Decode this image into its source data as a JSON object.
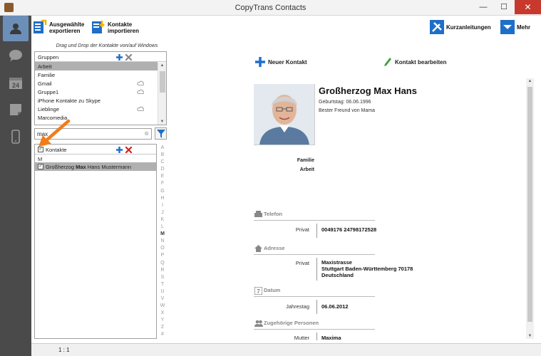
{
  "window": {
    "title": "CopyTrans Contacts",
    "minimize": "—",
    "maximize": "☐",
    "close": "✕"
  },
  "toolbar": {
    "export_label_1": "Ausgewählte",
    "export_label_2": "exportieren",
    "import_label_1": "Kontakte",
    "import_label_2": "importieren",
    "guides_label": "Kurzanleitungen",
    "more_label": "Mehr"
  },
  "sidebar": {
    "items": [
      "contacts-icon",
      "messages-icon",
      "calendar-icon",
      "notes-icon",
      "device-icon"
    ],
    "calendar_day": "24"
  },
  "left": {
    "hint": "Drag und Drop der Kontakte von/auf Windows",
    "groups_header": "Gruppen",
    "groups": [
      {
        "label": "Arbeit",
        "cloud": false,
        "selected": true
      },
      {
        "label": "Familie",
        "cloud": false
      },
      {
        "label": "Gmail",
        "cloud": true
      },
      {
        "label": "Gruppe1",
        "cloud": true
      },
      {
        "label": "iPhone Kontakte zu Skype",
        "cloud": false
      },
      {
        "label": "Lieblinge",
        "cloud": true
      },
      {
        "label": "Marcomedia",
        "cloud": false
      }
    ],
    "search_value": "max",
    "contacts_header": "Kontakte",
    "letter": "M",
    "contact_pre": "Großherzog ",
    "contact_bold": "Max",
    "contact_post": " Hans Mustermann",
    "alphabet": [
      "A",
      "B",
      "C",
      "D",
      "E",
      "F",
      "G",
      "H",
      "I",
      "J",
      "K",
      "L",
      "M",
      "N",
      "O",
      "P",
      "Q",
      "R",
      "S",
      "T",
      "U",
      "V",
      "W",
      "X",
      "Y",
      "Z",
      "#"
    ],
    "active_letter": "M"
  },
  "status": {
    "position": "1 : 1"
  },
  "main": {
    "new_contact": "Neuer Kontakt",
    "edit_contact": "Kontakt bearbeiten",
    "name": "Großherzog Max Hans",
    "birthday": "Geburtstag: 06.06.1996",
    "note": "Bester Freund von Mama",
    "groups": [
      "Familie",
      "Arbeit"
    ],
    "phone_section": "Telefon",
    "phone_label": "Privat",
    "phone_value": "0049176 24798172528",
    "address_section": "Adresse",
    "address_label": "Privat",
    "address_line1": "Maxistrasse",
    "address_line2": "Stuttgart Baden-Württemberg 70178",
    "address_line3": "Deutschland",
    "date_section": "Datum",
    "date_day": "7",
    "date_label": "Jahrestag",
    "date_value": "06.06.2012",
    "related_section": "Zugehörige Personen",
    "related_label": "Mutter",
    "related_value": "Maxima"
  },
  "colors": {
    "sidebar_bg": "#4a4a4a",
    "sidebar_active": "#6b8fb8",
    "accent_blue": "#1e6fc9",
    "close_red": "#c7392c",
    "delete_red": "#d42020",
    "arrow_orange": "#f07d1a"
  }
}
